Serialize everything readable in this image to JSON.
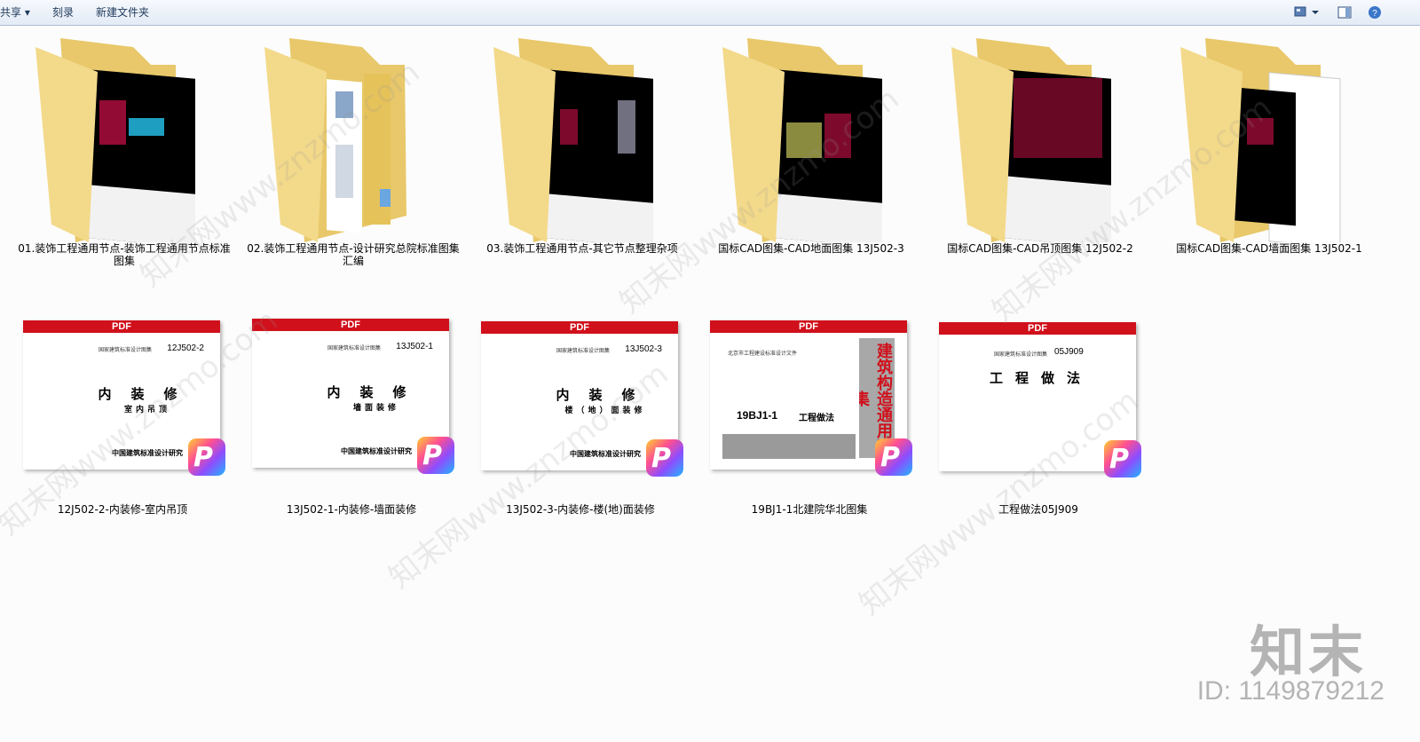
{
  "toolbar": {
    "share_label": "共享 ▾",
    "burn_label": "刻录",
    "new_folder_label": "新建文件夹"
  },
  "folders": [
    {
      "label": "01.装饰工程通用节点-装饰工程通用节点标准图集"
    },
    {
      "label": "02.装饰工程通用节点-设计研究总院标准图集汇编"
    },
    {
      "label": "03.装饰工程通用节点-其它节点整理杂项"
    },
    {
      "label": "国标CAD图集-CAD地面图集  13J502-3"
    },
    {
      "label": "国标CAD图集-CAD吊顶图集  12J502-2"
    },
    {
      "label": "国标CAD图集-CAD墙面图集  13J502-1"
    }
  ],
  "pdfs": [
    {
      "label": "12J502-2-内装修-室内吊顶",
      "badge": "PDF",
      "header": "国家建筑标准设计图集",
      "code": "12J502-2",
      "main": "内装修",
      "sub": "室内吊顶",
      "org": "中国建筑标准设计研究"
    },
    {
      "label": "13J502-1-内装修-墙面装修",
      "badge": "PDF",
      "header": "国家建筑标准设计图集",
      "code": "13J502-1",
      "main": "内装修",
      "sub": "墙面装修",
      "org": "中国建筑标准设计研究"
    },
    {
      "label": "13J502-3-内装修-楼(地)面装修",
      "badge": "PDF",
      "header": "国家建筑标准设计图集",
      "code": "13J502-3",
      "main": "内装修",
      "sub": "楼（地）面装修",
      "org": "中国建筑标准设计研究"
    },
    {
      "label": "19BJ1-1北建院华北图集",
      "badge": "PDF",
      "header": "北京市工程建设标准设计文件",
      "code": "19BJ1-1",
      "main": "工程做法",
      "side": "建筑构造通用图集"
    },
    {
      "label": "工程做法05J909",
      "badge": "PDF",
      "header": "国家建筑标准设计图集",
      "code": "05J909",
      "main": "工程做法"
    }
  ],
  "watermark": {
    "logo": "知末",
    "id_text": "ID: 1149879212",
    "site": "知末网www.znzmo.com"
  }
}
